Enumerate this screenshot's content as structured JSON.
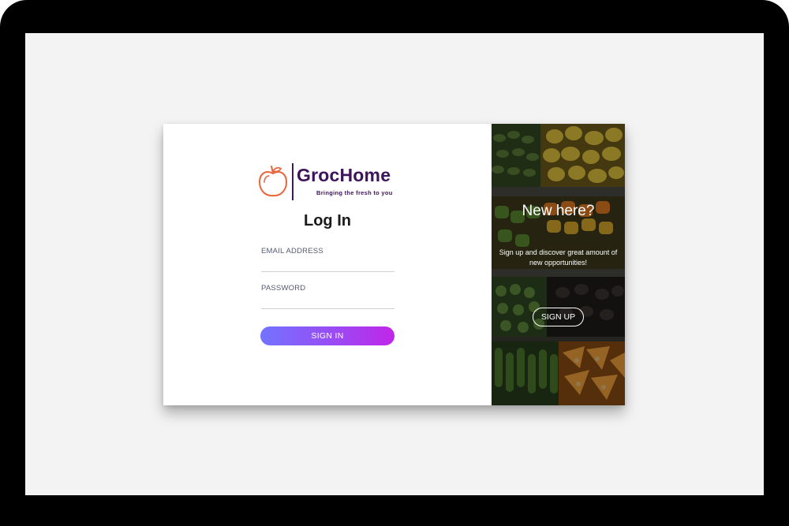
{
  "brand": {
    "name": "GrocHome",
    "tagline": "Bringing the fresh to you"
  },
  "login": {
    "title": "Log In",
    "email_label": "EMAIL ADDRESS",
    "email_value": "",
    "password_label": "PASSWORD",
    "password_value": "",
    "submit_label": "SIGN IN"
  },
  "promo": {
    "heading": "New here?",
    "text": "Sign up and discover great amount of new opportunities!",
    "button_label": "SIGN UP"
  },
  "colors": {
    "brand_purple": "#3d1459",
    "apple_orange": "#e8673c",
    "button_gradient_start": "#7373ff",
    "button_gradient_end": "#c026e9",
    "screen_bg": "#f3f3f3"
  }
}
